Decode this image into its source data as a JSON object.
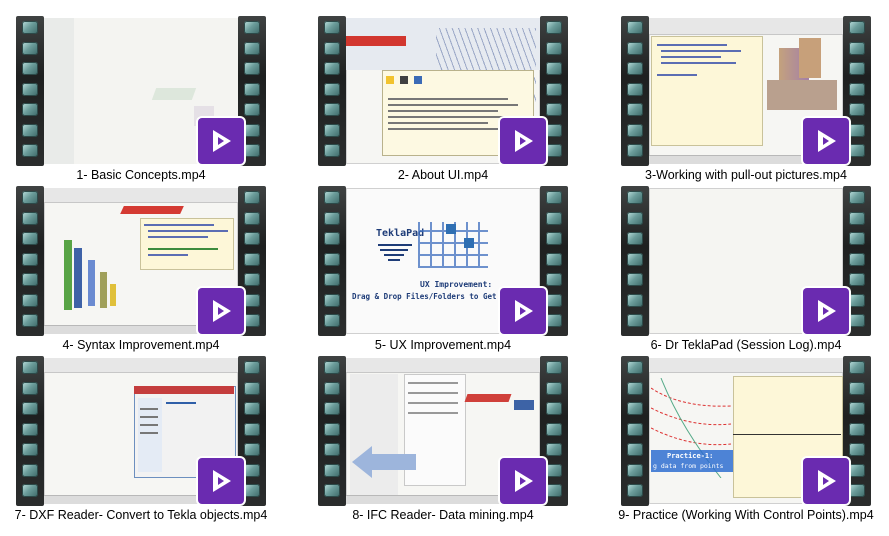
{
  "videos": [
    {
      "title": "1- Basic Concepts.mp4"
    },
    {
      "title": "2- About UI.mp4"
    },
    {
      "title": "3-Working with pull-out pictures.mp4"
    },
    {
      "title": "4- Syntax Improvement.mp4"
    },
    {
      "title": "5- UX Improvement.mp4"
    },
    {
      "title": "6- Dr TeklaPad (Session Log).mp4"
    },
    {
      "title": "7- DXF Reader- Convert to Tekla objects.mp4"
    },
    {
      "title": "8- IFC Reader- Data mining.mp4"
    },
    {
      "title": "9- Practice (Working With Control Points).mp4"
    }
  ],
  "thumb_text": {
    "teklapad_logo": "TeklaPad",
    "ux_line1": "UX Improvement:",
    "ux_line2": "Drag & Drop Files/Folders to Get Full Pa",
    "practice_label": "Practice-1:",
    "practice_sub": "g data from points"
  },
  "colors": {
    "play_badge": "#6a2bb0",
    "film_strip": "#2b2d2d",
    "sprocket": "#7fb3b0"
  },
  "icons": {
    "play": "play-triangle-icon"
  }
}
